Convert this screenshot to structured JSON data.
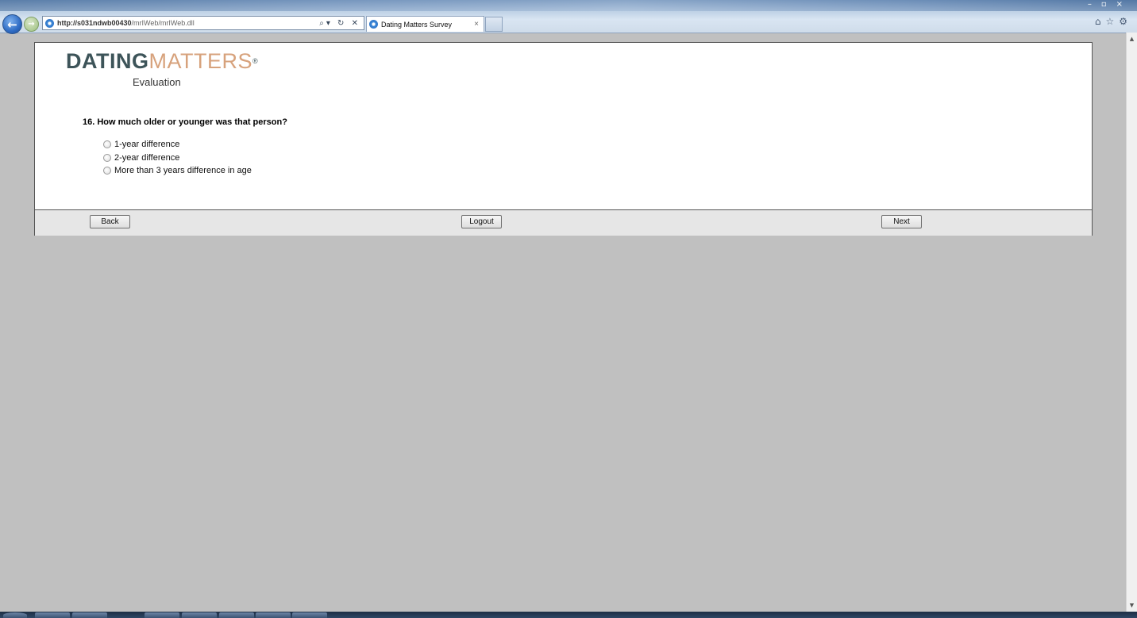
{
  "browser": {
    "url_host": "http://s031ndwb00430",
    "url_path": "/mrIWeb/mrIWeb.dll",
    "address_controls": "⌕▾ ↻ ✕",
    "tab_title": "Dating Matters Survey",
    "tab_close": "×",
    "window_controls": "–▫×",
    "toolbar_icons": "⌂☆⚙",
    "back_glyph": "←",
    "forward_glyph": "→"
  },
  "logo": {
    "dating": "DATING",
    "matters": "MATTERS",
    "reg": "®",
    "subtitle": "Evaluation"
  },
  "question": {
    "text": "16. How much older or younger was that person?",
    "options": [
      "1-year difference",
      "2-year difference",
      "More than 3 years difference in age"
    ]
  },
  "footer": {
    "back_label": "Back",
    "logout_label": "Logout",
    "next_label": "Next"
  },
  "scrollbar": {
    "up": "▲",
    "down": "▼"
  },
  "colors": {
    "logo_dark": "#3d5459",
    "logo_accent": "#d7a27c",
    "page_background": "#c0c0c0"
  }
}
